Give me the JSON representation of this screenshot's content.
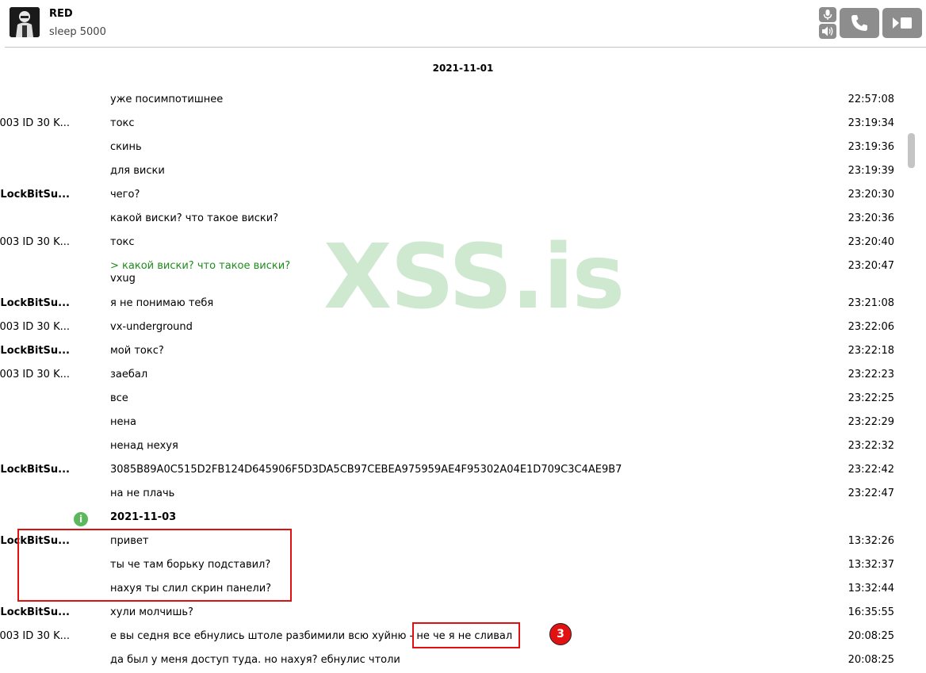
{
  "header": {
    "contact_name": "RED",
    "contact_status": "sleep 5000",
    "buttons": [
      "mic-icon",
      "speaker-icon",
      "call-icon",
      "video-icon"
    ]
  },
  "conversation": {
    "date": "2021-11-01",
    "messages": [
      {
        "sender": "",
        "text": "уже посимпотишнее",
        "time": "22:57:08"
      },
      {
        "sender": "003 ID 30 K...",
        "text": "токс",
        "time": "23:19:34"
      },
      {
        "sender": "",
        "text": "скинь",
        "time": "23:19:36"
      },
      {
        "sender": "",
        "text": "для виски",
        "time": "23:19:39"
      },
      {
        "sender": "LockBitSu...",
        "text": "чего?",
        "time": "23:20:30"
      },
      {
        "sender": "",
        "text": "какой виски? что такое виски?",
        "time": "23:20:36"
      },
      {
        "sender": "003 ID 30 K...",
        "text": "токс",
        "time": "23:20:40"
      },
      {
        "sender": "",
        "quote": "> какой виски? что такое виски?",
        "text": "vxug",
        "time": "23:20:47"
      },
      {
        "sender": "LockBitSu...",
        "text": "я не понимаю тебя",
        "time": "23:21:08"
      },
      {
        "sender": "003 ID 30 K...",
        "text": "vx-underground",
        "time": "23:22:06"
      },
      {
        "sender": "LockBitSu...",
        "text": "мой токс?",
        "time": "23:22:18"
      },
      {
        "sender": "003 ID 30 K...",
        "text": "заебал",
        "time": "23:22:23"
      },
      {
        "sender": "",
        "text": "все",
        "time": "23:22:25"
      },
      {
        "sender": "",
        "text": "нена",
        "time": "23:22:29"
      },
      {
        "sender": "",
        "text": "ненад нехуя",
        "time": "23:22:32"
      },
      {
        "sender": "LockBitSu...",
        "text": "3085B89A0C515D2FB124D645906F5D3DA5CB97CEBEA975959AE4F95302A04E1D709C3C4AE9B7",
        "time": "23:22:42"
      },
      {
        "sender": "",
        "text": "на не плачь",
        "time": "23:22:47"
      }
    ],
    "day_separator": "2021-11-03",
    "messages2": [
      {
        "sender": "LockBitSu...",
        "text": "привет",
        "time": "13:32:26"
      },
      {
        "sender": "",
        "text": "ты че там борьку подставил?",
        "time": "13:32:37"
      },
      {
        "sender": "",
        "text": "нахуя ты слил скрин панели?",
        "time": "13:32:44"
      },
      {
        "sender": "LockBitSu...",
        "text": "хули молчишь?",
        "time": "16:35:55"
      },
      {
        "sender": "003 ID 30 K...",
        "text": "е вы седня все ебнулись штоле разбимили всю хуйню - не че я не сливал",
        "time": "20:08:25"
      },
      {
        "sender": "",
        "text": "да был у меня доступ туда. но нахуя? ебнулис чтоли",
        "time": "20:08:25"
      }
    ]
  },
  "overlay": {
    "watermark": "XSS.is",
    "badge": "3",
    "colors": {
      "highlight": "#e01010",
      "badge": "#e31212",
      "quote": "#1e8c1e",
      "info": "#5cb85c"
    }
  }
}
